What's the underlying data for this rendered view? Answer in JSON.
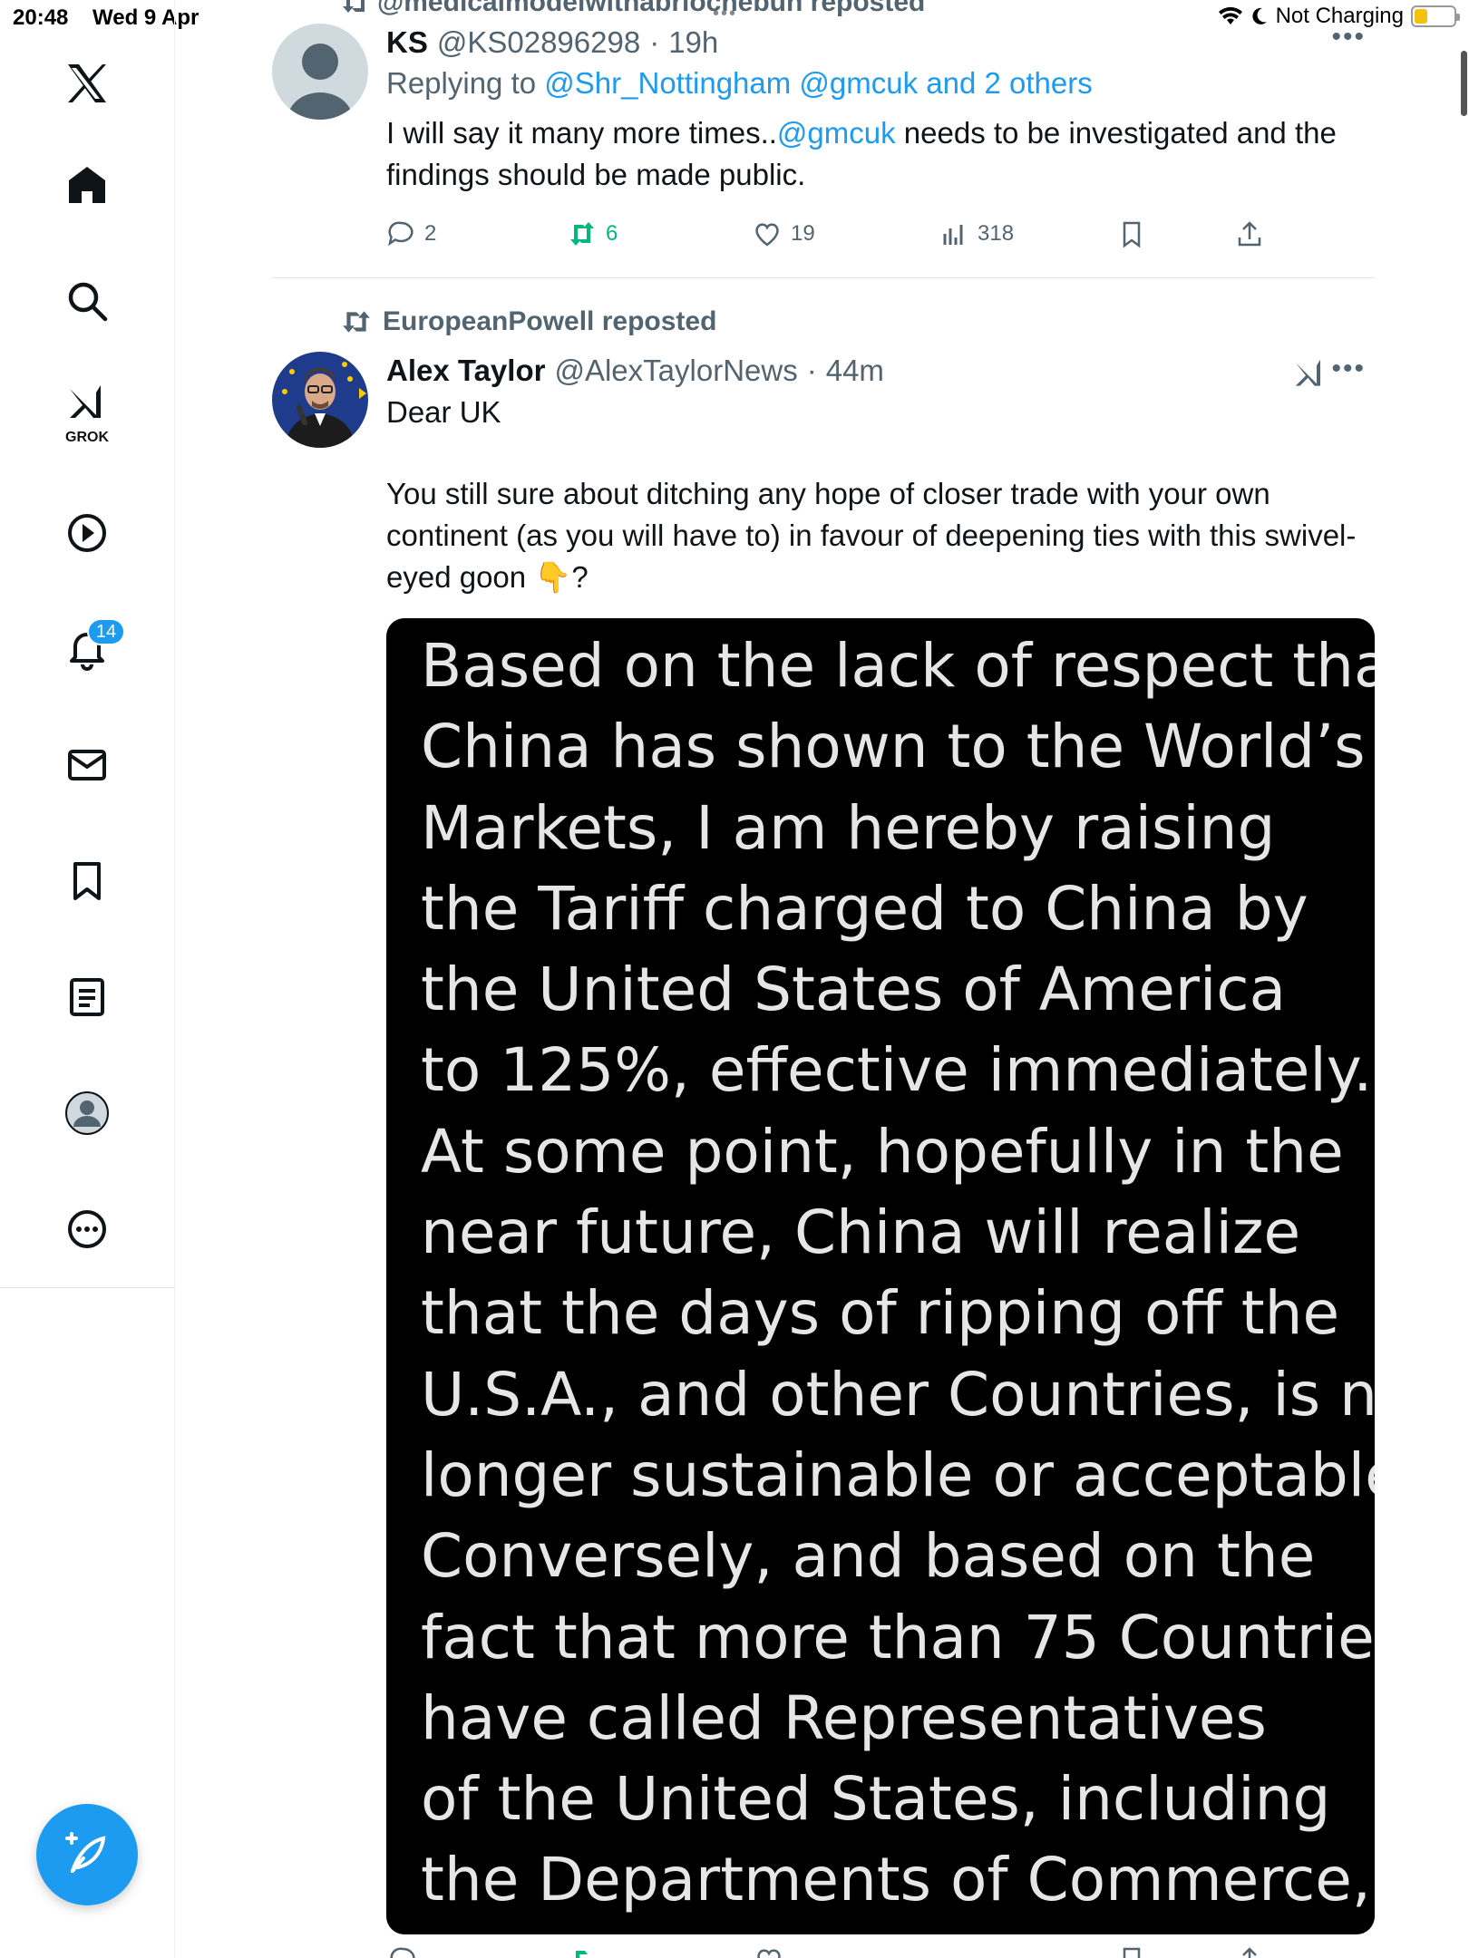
{
  "status_bar": {
    "time": "20:48",
    "date": "Wed 9 Apr",
    "charging": "Not Charging"
  },
  "sidebar": {
    "items": [
      {
        "name": "x-logo",
        "icon": "x-logo-icon"
      },
      {
        "name": "home",
        "icon": "home-icon"
      },
      {
        "name": "explore",
        "icon": "search-icon"
      },
      {
        "name": "grok",
        "icon": "grok-icon",
        "label": "GROK"
      },
      {
        "name": "video",
        "icon": "play-icon"
      },
      {
        "name": "notifications",
        "icon": "bell-icon",
        "badge": "14"
      },
      {
        "name": "messages",
        "icon": "mail-icon"
      },
      {
        "name": "bookmarks",
        "icon": "bookmark-icon"
      },
      {
        "name": "lists",
        "icon": "list-icon"
      },
      {
        "name": "profile",
        "icon": "profile-icon"
      },
      {
        "name": "more",
        "icon": "more-circle-icon"
      }
    ],
    "compose_icon": "compose-feather-icon"
  },
  "timeline": {
    "top_repost": "@medicalmodelwithabriochebun reposted",
    "tweets": [
      {
        "name": "KS",
        "handle": "@KS02896298",
        "time": "19h",
        "reply_prefix": "Replying to",
        "reply_to": "@Shr_Nottingham @gmcuk and 2 others",
        "text_before": "I will say it many more times..",
        "mention": "@gmcuk",
        "text_after": "  needs to be investigated and the findings should be made public.",
        "replies": "2",
        "retweets": "6",
        "likes": "19",
        "views": "318"
      },
      {
        "reposted_by": "EuropeanPowell reposted",
        "name": "Alex Taylor",
        "handle": "@AlexTaylorNews",
        "time": "44m",
        "text_line1": "Dear UK",
        "text_line2": "You still sure about ditching any hope of closer trade with your own continent (as you will have to) in favour of deepening ties with this swivel-eyed goon 👇?",
        "media_text": "Based on the lack of respect that\nChina has shown to the World’s\nMarkets, I am hereby raising\nthe Tariff charged to China by\nthe United States of America\nto 125%, effective immediately.\nAt some point, hopefully in the\nnear future, China will realize\nthat the days of ripping off the\nU.S.A., and other Countries, is no\nlonger sustainable or acceptable.\nConversely, and based on the\nfact that more than 75 Countries\nhave called Representatives\nof the United States, including\nthe Departments of Commerce,\nTreasury, and the USTR, to"
      }
    ]
  },
  "colors": {
    "accent": "#1d9bf0",
    "retweet_green": "#00ba7c",
    "secondary_text": "#536471"
  }
}
